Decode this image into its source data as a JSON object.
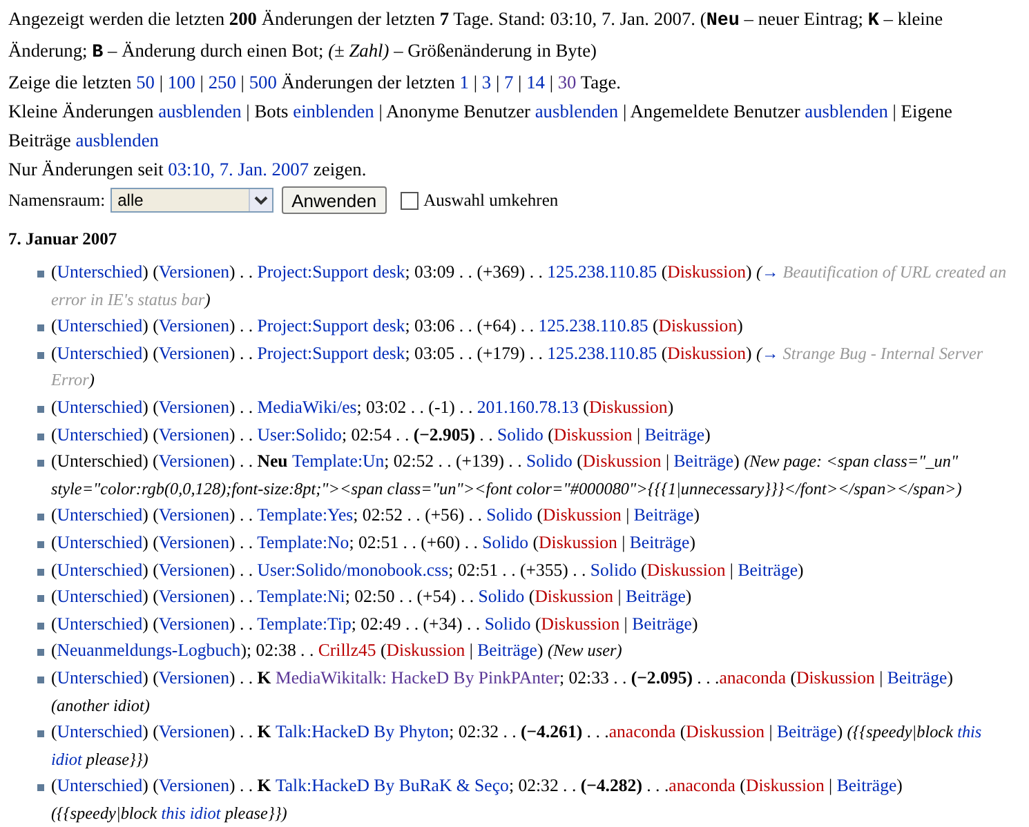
{
  "intro": [
    [
      {
        "kind": "text",
        "text": "Angezeigt werden die letzten "
      },
      {
        "kind": "bold",
        "text": "200"
      },
      {
        "kind": "text",
        "text": " Änderungen der letzten "
      },
      {
        "kind": "bold",
        "text": "7"
      },
      {
        "kind": "text",
        "text": " Tage. Stand: 03:10, 7. Jan. 2007. ("
      },
      {
        "kind": "key",
        "text": "Neu"
      },
      {
        "kind": "text",
        "text": " – neuer Eintrag; "
      },
      {
        "kind": "key",
        "text": "K"
      },
      {
        "kind": "text",
        "text": " – kleine"
      },
      {
        "kind": "break"
      },
      {
        "kind": "text",
        "text": "Änderung; "
      },
      {
        "kind": "key",
        "text": "B"
      },
      {
        "kind": "text",
        "text": " – Änderung durch einen Bot; "
      },
      {
        "kind": "italic",
        "text": "(± Zahl)"
      },
      {
        "kind": "text",
        "text": " – Größenänderung in Byte)"
      }
    ],
    [
      {
        "kind": "text",
        "text": "Zeige die letzten "
      },
      {
        "kind": "link",
        "text": "50"
      },
      {
        "kind": "text",
        "text": " | "
      },
      {
        "kind": "link",
        "text": "100"
      },
      {
        "kind": "text",
        "text": " | "
      },
      {
        "kind": "link",
        "text": "250"
      },
      {
        "kind": "text",
        "text": " | "
      },
      {
        "kind": "link",
        "text": "500"
      },
      {
        "kind": "text",
        "text": " Änderungen der letzten "
      },
      {
        "kind": "link",
        "text": "1"
      },
      {
        "kind": "text",
        "text": " | "
      },
      {
        "kind": "link",
        "text": "3"
      },
      {
        "kind": "text",
        "text": " | "
      },
      {
        "kind": "link",
        "text": "7"
      },
      {
        "kind": "text",
        "text": " | "
      },
      {
        "kind": "link",
        "text": "14"
      },
      {
        "kind": "text",
        "text": " | "
      },
      {
        "kind": "visited",
        "text": "30"
      },
      {
        "kind": "text",
        "text": " Tage."
      }
    ],
    [
      {
        "kind": "text",
        "text": "Kleine Änderungen "
      },
      {
        "kind": "link",
        "text": "ausblenden"
      },
      {
        "kind": "text",
        "text": " | Bots "
      },
      {
        "kind": "link",
        "text": "einblenden"
      },
      {
        "kind": "text",
        "text": " | Anonyme Benutzer "
      },
      {
        "kind": "link",
        "text": "ausblenden"
      },
      {
        "kind": "text",
        "text": " | Angemeldete Benutzer "
      },
      {
        "kind": "link",
        "text": "ausblenden"
      },
      {
        "kind": "text",
        "text": " | Eigene"
      },
      {
        "kind": "break"
      },
      {
        "kind": "text",
        "text": "Beiträge "
      },
      {
        "kind": "link",
        "text": "ausblenden"
      }
    ],
    [
      {
        "kind": "text",
        "text": "Nur Änderungen seit "
      },
      {
        "kind": "link",
        "text": "03:10, 7. Jan. 2007"
      },
      {
        "kind": "text",
        "text": " zeigen."
      }
    ]
  ],
  "filter": {
    "label": "Namensraum:",
    "select": "alle",
    "button": "Anwenden",
    "invert": {
      "label": "Auswahl umkehren",
      "checked": false
    }
  },
  "date_heading": "7. Januar 2007",
  "changes": [
    [
      {
        "kind": "text",
        "text": "("
      },
      {
        "kind": "link",
        "text": "Unterschied"
      },
      {
        "kind": "text",
        "text": ") ("
      },
      {
        "kind": "link",
        "text": "Versionen"
      },
      {
        "kind": "text",
        "text": ") . . "
      },
      {
        "kind": "link",
        "text": "Project:Support desk"
      },
      {
        "kind": "text",
        "text": "; 03:09 . . (+369) . . "
      },
      {
        "kind": "link",
        "text": "125.238.110.85"
      },
      {
        "kind": "text",
        "text": " ("
      },
      {
        "kind": "redlink",
        "text": "Diskussion"
      },
      {
        "kind": "text",
        "text": ") "
      },
      {
        "kind": "comment",
        "text": "("
      },
      {
        "kind": "clink",
        "text": "→"
      },
      {
        "kind": "auto",
        "text": " Beautification of URL created an"
      },
      {
        "kind": "break"
      },
      {
        "kind": "auto",
        "text": "error in IE's status bar"
      },
      {
        "kind": "comment",
        "text": ")"
      }
    ],
    [
      {
        "kind": "text",
        "text": "("
      },
      {
        "kind": "link",
        "text": "Unterschied"
      },
      {
        "kind": "text",
        "text": ") ("
      },
      {
        "kind": "link",
        "text": "Versionen"
      },
      {
        "kind": "text",
        "text": ") . . "
      },
      {
        "kind": "link",
        "text": "Project:Support desk"
      },
      {
        "kind": "text",
        "text": "; 03:06 . . (+64) . . "
      },
      {
        "kind": "link",
        "text": "125.238.110.85"
      },
      {
        "kind": "text",
        "text": " ("
      },
      {
        "kind": "redlink",
        "text": "Diskussion"
      },
      {
        "kind": "text",
        "text": ")"
      }
    ],
    [
      {
        "kind": "text",
        "text": "("
      },
      {
        "kind": "link",
        "text": "Unterschied"
      },
      {
        "kind": "text",
        "text": ") ("
      },
      {
        "kind": "link",
        "text": "Versionen"
      },
      {
        "kind": "text",
        "text": ") . . "
      },
      {
        "kind": "link",
        "text": "Project:Support desk"
      },
      {
        "kind": "text",
        "text": "; 03:05 . . (+179) . . "
      },
      {
        "kind": "link",
        "text": "125.238.110.85"
      },
      {
        "kind": "text",
        "text": " ("
      },
      {
        "kind": "redlink",
        "text": "Diskussion"
      },
      {
        "kind": "text",
        "text": ") "
      },
      {
        "kind": "comment",
        "text": "("
      },
      {
        "kind": "clink",
        "text": "→"
      },
      {
        "kind": "auto",
        "text": " Strange Bug - Internal Server"
      },
      {
        "kind": "break"
      },
      {
        "kind": "auto",
        "text": "Error"
      },
      {
        "kind": "comment",
        "text": ")"
      }
    ],
    [
      {
        "kind": "text",
        "text": "("
      },
      {
        "kind": "link",
        "text": "Unterschied"
      },
      {
        "kind": "text",
        "text": ") ("
      },
      {
        "kind": "link",
        "text": "Versionen"
      },
      {
        "kind": "text",
        "text": ") . . "
      },
      {
        "kind": "link",
        "text": "MediaWiki/es"
      },
      {
        "kind": "text",
        "text": "; 03:02 . . (-1) . . "
      },
      {
        "kind": "link",
        "text": "201.160.78.13"
      },
      {
        "kind": "text",
        "text": " ("
      },
      {
        "kind": "redlink",
        "text": "Diskussion"
      },
      {
        "kind": "text",
        "text": ")"
      }
    ],
    [
      {
        "kind": "text",
        "text": "("
      },
      {
        "kind": "link",
        "text": "Unterschied"
      },
      {
        "kind": "text",
        "text": ") ("
      },
      {
        "kind": "link",
        "text": "Versionen"
      },
      {
        "kind": "text",
        "text": ") . . "
      },
      {
        "kind": "link",
        "text": "User:Solido"
      },
      {
        "kind": "text",
        "text": "; 02:54 . . "
      },
      {
        "kind": "bold",
        "text": "(−2.905)"
      },
      {
        "kind": "text",
        "text": " . . "
      },
      {
        "kind": "link",
        "text": "Solido"
      },
      {
        "kind": "text",
        "text": " ("
      },
      {
        "kind": "redlink",
        "text": "Diskussion"
      },
      {
        "kind": "text",
        "text": " | "
      },
      {
        "kind": "link",
        "text": "Beiträge"
      },
      {
        "kind": "text",
        "text": ")"
      }
    ],
    [
      {
        "kind": "text",
        "text": "(Unterschied) ("
      },
      {
        "kind": "link",
        "text": "Versionen"
      },
      {
        "kind": "text",
        "text": ") . . "
      },
      {
        "kind": "flag",
        "text": "Neu "
      },
      {
        "kind": "link",
        "text": "Template:Un"
      },
      {
        "kind": "text",
        "text": "; 02:52 . . (+139) . . "
      },
      {
        "kind": "link",
        "text": "Solido"
      },
      {
        "kind": "text",
        "text": " ("
      },
      {
        "kind": "redlink",
        "text": "Diskussion"
      },
      {
        "kind": "text",
        "text": " | "
      },
      {
        "kind": "link",
        "text": "Beiträge"
      },
      {
        "kind": "text",
        "text": ") "
      },
      {
        "kind": "comment",
        "text": "(New page: <span class=\"_un\""
      },
      {
        "kind": "break"
      },
      {
        "kind": "comment",
        "text": "style=\"color:rgb(0,0,128);font-size:8pt;\"><span class=\"un\"><font color=\"#000080\">{{{1|unnecessary}}}</font></span></span>)"
      }
    ],
    [
      {
        "kind": "text",
        "text": "("
      },
      {
        "kind": "link",
        "text": "Unterschied"
      },
      {
        "kind": "text",
        "text": ") ("
      },
      {
        "kind": "link",
        "text": "Versionen"
      },
      {
        "kind": "text",
        "text": ") . . "
      },
      {
        "kind": "link",
        "text": "Template:Yes"
      },
      {
        "kind": "text",
        "text": "; 02:52 . . (+56) . . "
      },
      {
        "kind": "link",
        "text": "Solido"
      },
      {
        "kind": "text",
        "text": " ("
      },
      {
        "kind": "redlink",
        "text": "Diskussion"
      },
      {
        "kind": "text",
        "text": " | "
      },
      {
        "kind": "link",
        "text": "Beiträge"
      },
      {
        "kind": "text",
        "text": ")"
      }
    ],
    [
      {
        "kind": "text",
        "text": "("
      },
      {
        "kind": "link",
        "text": "Unterschied"
      },
      {
        "kind": "text",
        "text": ") ("
      },
      {
        "kind": "link",
        "text": "Versionen"
      },
      {
        "kind": "text",
        "text": ") . . "
      },
      {
        "kind": "link",
        "text": "Template:No"
      },
      {
        "kind": "text",
        "text": "; 02:51 . . (+60) . . "
      },
      {
        "kind": "link",
        "text": "Solido"
      },
      {
        "kind": "text",
        "text": " ("
      },
      {
        "kind": "redlink",
        "text": "Diskussion"
      },
      {
        "kind": "text",
        "text": " | "
      },
      {
        "kind": "link",
        "text": "Beiträge"
      },
      {
        "kind": "text",
        "text": ")"
      }
    ],
    [
      {
        "kind": "text",
        "text": "("
      },
      {
        "kind": "link",
        "text": "Unterschied"
      },
      {
        "kind": "text",
        "text": ") ("
      },
      {
        "kind": "link",
        "text": "Versionen"
      },
      {
        "kind": "text",
        "text": ") . . "
      },
      {
        "kind": "link",
        "text": "User:Solido/monobook.css"
      },
      {
        "kind": "text",
        "text": "; 02:51 . . (+355) . . "
      },
      {
        "kind": "link",
        "text": "Solido"
      },
      {
        "kind": "text",
        "text": " ("
      },
      {
        "kind": "redlink",
        "text": "Diskussion"
      },
      {
        "kind": "text",
        "text": " | "
      },
      {
        "kind": "link",
        "text": "Beiträge"
      },
      {
        "kind": "text",
        "text": ")"
      }
    ],
    [
      {
        "kind": "text",
        "text": "("
      },
      {
        "kind": "link",
        "text": "Unterschied"
      },
      {
        "kind": "text",
        "text": ") ("
      },
      {
        "kind": "link",
        "text": "Versionen"
      },
      {
        "kind": "text",
        "text": ") . . "
      },
      {
        "kind": "link",
        "text": "Template:Ni"
      },
      {
        "kind": "text",
        "text": "; 02:50 . . (+54) . . "
      },
      {
        "kind": "link",
        "text": "Solido"
      },
      {
        "kind": "text",
        "text": " ("
      },
      {
        "kind": "redlink",
        "text": "Diskussion"
      },
      {
        "kind": "text",
        "text": " | "
      },
      {
        "kind": "link",
        "text": "Beiträge"
      },
      {
        "kind": "text",
        "text": ")"
      }
    ],
    [
      {
        "kind": "text",
        "text": "("
      },
      {
        "kind": "link",
        "text": "Unterschied"
      },
      {
        "kind": "text",
        "text": ") ("
      },
      {
        "kind": "link",
        "text": "Versionen"
      },
      {
        "kind": "text",
        "text": ") . . "
      },
      {
        "kind": "link",
        "text": "Template:Tip"
      },
      {
        "kind": "text",
        "text": "; 02:49 . . (+34) . . "
      },
      {
        "kind": "link",
        "text": "Solido"
      },
      {
        "kind": "text",
        "text": " ("
      },
      {
        "kind": "redlink",
        "text": "Diskussion"
      },
      {
        "kind": "text",
        "text": " | "
      },
      {
        "kind": "link",
        "text": "Beiträge"
      },
      {
        "kind": "text",
        "text": ")"
      }
    ],
    [
      {
        "kind": "text",
        "text": "("
      },
      {
        "kind": "link",
        "text": "Neuanmeldungs-Logbuch"
      },
      {
        "kind": "text",
        "text": "); 02:38 . . "
      },
      {
        "kind": "redlink",
        "text": "Crillz45"
      },
      {
        "kind": "text",
        "text": " ("
      },
      {
        "kind": "redlink",
        "text": "Diskussion"
      },
      {
        "kind": "text",
        "text": " | "
      },
      {
        "kind": "link",
        "text": "Beiträge"
      },
      {
        "kind": "text",
        "text": ") "
      },
      {
        "kind": "comment",
        "text": "(New user)"
      }
    ],
    [
      {
        "kind": "text",
        "text": "("
      },
      {
        "kind": "link",
        "text": "Unterschied"
      },
      {
        "kind": "text",
        "text": ") ("
      },
      {
        "kind": "link",
        "text": "Versionen"
      },
      {
        "kind": "text",
        "text": ") . . "
      },
      {
        "kind": "flag",
        "text": "K "
      },
      {
        "kind": "visited",
        "text": "MediaWikitalk: HackeD By PinkPAnter"
      },
      {
        "kind": "text",
        "text": "; 02:33 . . "
      },
      {
        "kind": "bold",
        "text": "(−2.095)"
      },
      {
        "kind": "text",
        "text": " . . ."
      },
      {
        "kind": "redlink",
        "text": "anaconda"
      },
      {
        "kind": "text",
        "text": " ("
      },
      {
        "kind": "redlink",
        "text": "Diskussion"
      },
      {
        "kind": "text",
        "text": " | "
      },
      {
        "kind": "link",
        "text": "Beiträge"
      },
      {
        "kind": "text",
        "text": ")"
      },
      {
        "kind": "break"
      },
      {
        "kind": "comment",
        "text": "(another idiot)"
      }
    ],
    [
      {
        "kind": "text",
        "text": "("
      },
      {
        "kind": "link",
        "text": "Unterschied"
      },
      {
        "kind": "text",
        "text": ") ("
      },
      {
        "kind": "link",
        "text": "Versionen"
      },
      {
        "kind": "text",
        "text": ") . . "
      },
      {
        "kind": "flag",
        "text": "K "
      },
      {
        "kind": "link",
        "text": "Talk:HackeD By Phyton"
      },
      {
        "kind": "text",
        "text": "; 02:32 . . "
      },
      {
        "kind": "bold",
        "text": "(−4.261)"
      },
      {
        "kind": "text",
        "text": " . . ."
      },
      {
        "kind": "redlink",
        "text": "anaconda"
      },
      {
        "kind": "text",
        "text": " ("
      },
      {
        "kind": "redlink",
        "text": "Diskussion"
      },
      {
        "kind": "text",
        "text": " | "
      },
      {
        "kind": "link",
        "text": "Beiträge"
      },
      {
        "kind": "text",
        "text": ") "
      },
      {
        "kind": "comment",
        "text": "({{speedy|block "
      },
      {
        "kind": "clink",
        "text": "this"
      },
      {
        "kind": "break"
      },
      {
        "kind": "clink",
        "text": "idiot"
      },
      {
        "kind": "comment",
        "text": " please}})"
      }
    ],
    [
      {
        "kind": "text",
        "text": "("
      },
      {
        "kind": "link",
        "text": "Unterschied"
      },
      {
        "kind": "text",
        "text": ") ("
      },
      {
        "kind": "link",
        "text": "Versionen"
      },
      {
        "kind": "text",
        "text": ") . . "
      },
      {
        "kind": "flag",
        "text": "K "
      },
      {
        "kind": "link",
        "text": "Talk:HackeD By BuRaK & Seço"
      },
      {
        "kind": "text",
        "text": "; 02:32 . . "
      },
      {
        "kind": "bold",
        "text": "(−4.282)"
      },
      {
        "kind": "text",
        "text": " . . ."
      },
      {
        "kind": "redlink",
        "text": "anaconda"
      },
      {
        "kind": "text",
        "text": " ("
      },
      {
        "kind": "redlink",
        "text": "Diskussion"
      },
      {
        "kind": "text",
        "text": " | "
      },
      {
        "kind": "link",
        "text": "Beiträge"
      },
      {
        "kind": "text",
        "text": ")"
      },
      {
        "kind": "break"
      },
      {
        "kind": "comment",
        "text": "({{speedy|block "
      },
      {
        "kind": "clink",
        "text": "this idiot"
      },
      {
        "kind": "comment",
        "text": " please}})"
      }
    ]
  ]
}
